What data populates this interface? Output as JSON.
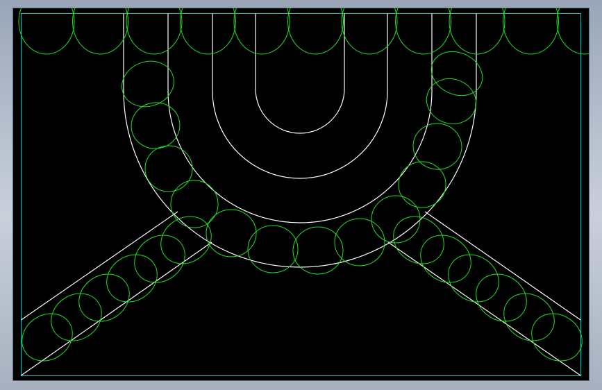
{
  "colors": {
    "background": "#000000",
    "frame": "#a6b0bf",
    "border": "#00c8c8",
    "lines": "#ffffff",
    "arcs": "#22e022"
  }
}
